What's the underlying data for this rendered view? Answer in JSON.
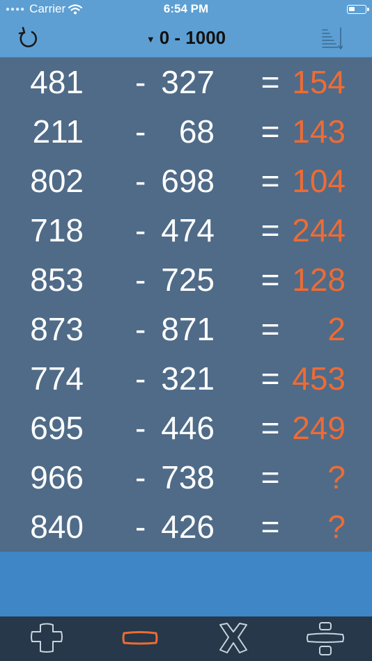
{
  "status": {
    "carrier": "Carrier",
    "time": "6:54 PM"
  },
  "nav": {
    "range": "0 - 1000"
  },
  "rows": [
    {
      "a": "481",
      "op": "-",
      "b": "327",
      "eq": "=",
      "ans": "154"
    },
    {
      "a": "211",
      "op": "-",
      "b": "68",
      "eq": "=",
      "ans": "143"
    },
    {
      "a": "802",
      "op": "-",
      "b": "698",
      "eq": "=",
      "ans": "104"
    },
    {
      "a": "718",
      "op": "-",
      "b": "474",
      "eq": "=",
      "ans": "244"
    },
    {
      "a": "853",
      "op": "-",
      "b": "725",
      "eq": "=",
      "ans": "128"
    },
    {
      "a": "873",
      "op": "-",
      "b": "871",
      "eq": "=",
      "ans": "2"
    },
    {
      "a": "774",
      "op": "-",
      "b": "321",
      "eq": "=",
      "ans": "453"
    },
    {
      "a": "695",
      "op": "-",
      "b": "446",
      "eq": "=",
      "ans": "249"
    },
    {
      "a": "966",
      "op": "-",
      "b": "738",
      "eq": "=",
      "ans": "?"
    },
    {
      "a": "840",
      "op": "-",
      "b": "426",
      "eq": "=",
      "ans": "?"
    }
  ],
  "tabs": [
    {
      "name": "addition",
      "icon": "plus-icon"
    },
    {
      "name": "subtraction",
      "icon": "minus-icon",
      "active": true
    },
    {
      "name": "multiplication",
      "icon": "multiply-icon"
    },
    {
      "name": "division",
      "icon": "divide-icon"
    }
  ],
  "colors": {
    "accent": "#ef6b33",
    "panel": "#4f6b88",
    "bar": "#5d9fd3",
    "tabbar": "#263849"
  }
}
